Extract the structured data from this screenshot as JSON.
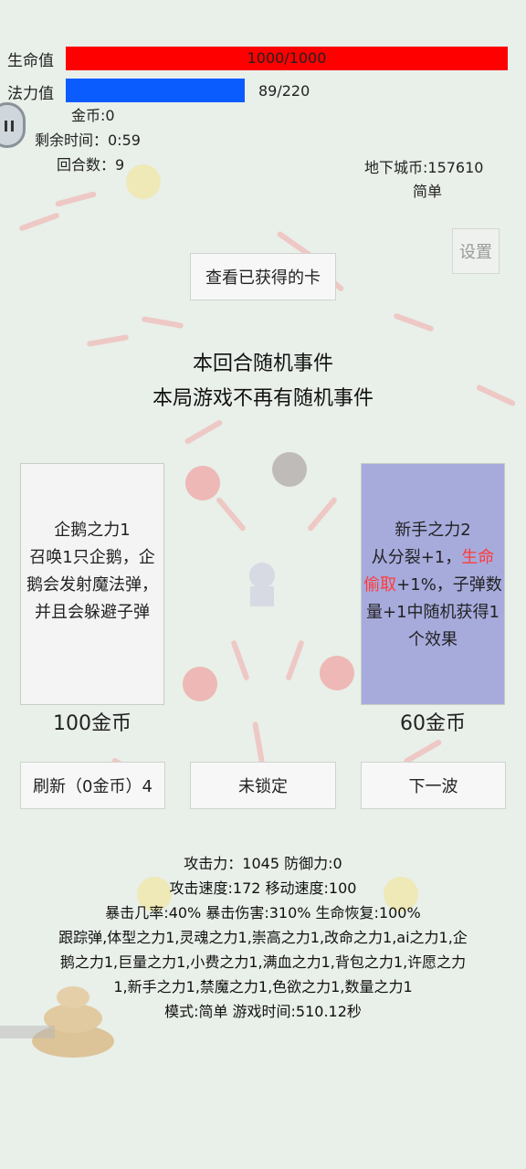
{
  "hud": {
    "hp_label": "生命值",
    "hp_text": "1000/1000",
    "mp_label": "法力值",
    "mp_text": "89/220",
    "gold": "金币:0",
    "time_left": "剩余时间：0:59",
    "round": "回合数：9",
    "dungeon_coins": "地下城币:157610",
    "difficulty": "简单"
  },
  "buttons": {
    "settings": "设置",
    "view_cards": "查看已获得的卡",
    "refresh": "刷新（0金币）4",
    "lock": "未锁定",
    "next_wave": "下一波"
  },
  "event": {
    "title": "本回合随机事件",
    "text": "本局游戏不再有随机事件"
  },
  "cards": [
    {
      "name": "企鹅之力1",
      "desc": "召唤1只企鹅，企鹅会发射魔法弹，并且会躲避子弹",
      "price": "100金币"
    },
    {
      "name": "新手之力2",
      "desc_part1": "从分裂+1，",
      "desc_highlight": "生命偷取",
      "desc_part2": "+1%，子弹数量+1中随机获得1个效果",
      "price": "60金币"
    }
  ],
  "stats": {
    "line1": "攻击力：1045 防御力:0",
    "line2": "攻击速度:172 移动速度:100",
    "line3": "暴击几率:40% 暴击伤害:310% 生命恢复:100%",
    "powers_line1": "跟踪弹,体型之力1,灵魂之力1,崇高之力1,改命之力1,ai之力1,企",
    "powers_line2": "鹅之力1,巨量之力1,小费之力1,满血之力1,背包之力1,许愿之力",
    "powers_line3": "1,新手之力1,禁魔之力1,色欲之力1,数量之力1",
    "mode_line": "模式:简单 游戏时间:510.12秒"
  },
  "colors": {
    "hp": "#ff0000",
    "mp": "#0a5cff",
    "card_selected": "#a7abdc",
    "highlight": "#ff3b3b"
  },
  "progress": {
    "hp_fraction": 1.0,
    "mp_fraction": 0.4045
  }
}
